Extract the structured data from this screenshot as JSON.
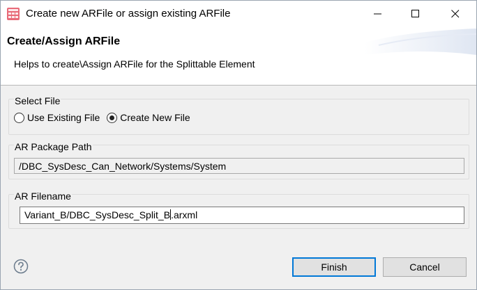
{
  "window": {
    "title": "Create new ARFile or assign existing ARFile",
    "app_icon": "grid-app-icon",
    "controls": {
      "minimize_icon": "minimize-icon",
      "maximize_icon": "maximize-icon",
      "close_icon": "close-icon"
    }
  },
  "header": {
    "title": "Create/Assign ARFile",
    "description": "Helps to create\\Assign ARFile for the Splittable Element"
  },
  "select_file": {
    "label": "Select File",
    "options": [
      {
        "label": "Use Existing File",
        "checked": false
      },
      {
        "label": "Create New File",
        "checked": true
      }
    ]
  },
  "package_path": {
    "label": "AR Package Path",
    "value": "/DBC_SysDesc_Can_Network/Systems/System"
  },
  "filename": {
    "label": "AR Filename",
    "value_before_caret": "Variant_B/DBC_SysDesc_Split_B",
    "value_after_caret": ".arxml"
  },
  "footer": {
    "help_icon": "help-icon",
    "finish_label": "Finish",
    "cancel_label": "Cancel"
  },
  "colors": {
    "accent": "#0078d7",
    "app_icon": "#d84a5a"
  }
}
